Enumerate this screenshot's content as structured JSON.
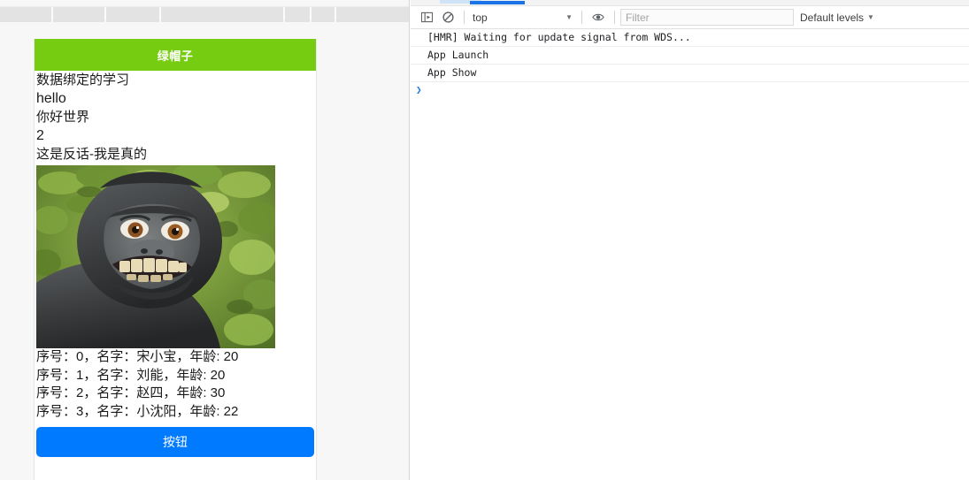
{
  "app": {
    "header_title": "绿帽子",
    "header_color": "#76cc10",
    "text_lines": [
      "数据绑定的学习",
      "hello",
      "你好世界",
      "2",
      "这是反话-我是真的"
    ],
    "image_alt": "monkey-selfie-photo",
    "list_items": [
      "序号：0，名字：宋小宝，年龄: 20",
      "序号：1，名字：刘能，年龄: 20",
      "序号：2，名字：赵四，年龄: 30",
      "序号：3，名字：小沈阳，年龄: 22"
    ],
    "button_label": "按钮",
    "button_color": "#007aff"
  },
  "devtools": {
    "toolbar": {
      "sidebar_toggle_icon": "show-console-sidebar-icon",
      "clear_icon": "clear-console-icon",
      "context_value": "top",
      "eye_icon": "live-expression-icon",
      "filter_placeholder": "Filter",
      "filter_value": "",
      "levels_label": "Default levels",
      "caret_glyph": "▼"
    },
    "console_messages": [
      "[HMR] Waiting for update signal from WDS...",
      "App Launch",
      "App Show"
    ],
    "prompt_glyph": "❯",
    "active_tab_color": "#1a73e8"
  }
}
